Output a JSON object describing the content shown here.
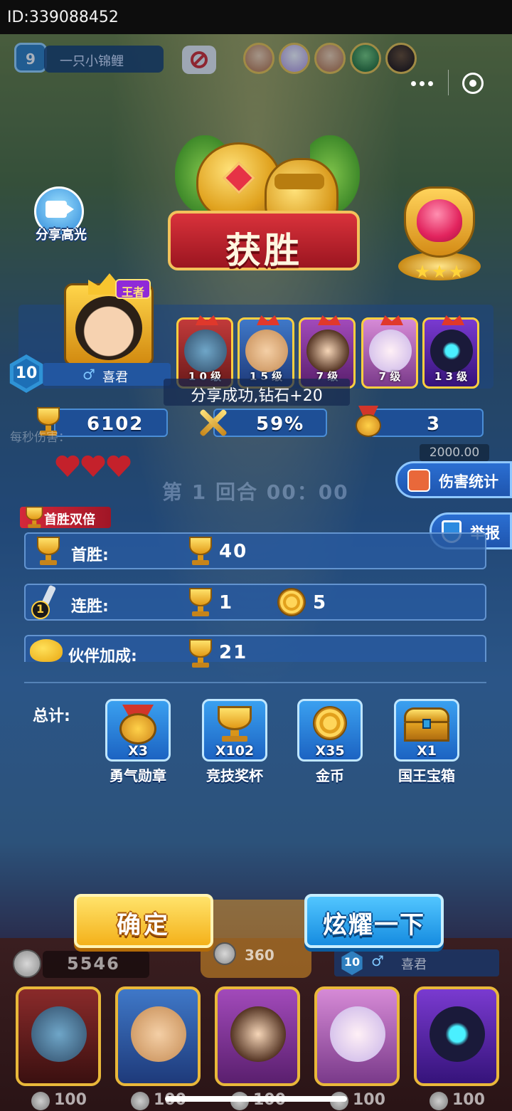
{
  "id_bar": {
    "text": "ID:339088452"
  },
  "hud": {
    "level": "9",
    "player_name": "一只小锦鲤",
    "mute_icon": "no-sound-icon"
  },
  "capsule": {
    "more_icon": "more-dots-icon",
    "close_icon": "target-close-icon"
  },
  "share_highlight": {
    "label": "分享高光",
    "icon": "video-camera-icon"
  },
  "victory": {
    "title": "获胜",
    "icon": "trophy-knight-icon"
  },
  "rank": {
    "icon": "heart-rank-badge-icon",
    "stars": 3
  },
  "player": {
    "crown_tag": "王者",
    "level": "10",
    "gender_icon": "♂",
    "name": "喜君",
    "heroes": [
      {
        "label": "1 0 级",
        "color": "#b02a2a"
      },
      {
        "label": "1 5 级",
        "color": "#2f5fb0"
      },
      {
        "label": "7 级",
        "color": "#8a3aa8"
      },
      {
        "label": "7 级",
        "color": "#c77cc7"
      },
      {
        "label": "1 3 级",
        "color": "#6b2ab0"
      }
    ]
  },
  "toast": "分享成功,钻石+20",
  "stats": {
    "trophies": "6102",
    "win_rate": "59%",
    "medals": "3"
  },
  "background": {
    "per_second": "每秒伤害：",
    "hp_value": "2000.00",
    "round": "第 1 回合 00：00"
  },
  "side_buttons": {
    "damage_stats": "伤害统计",
    "report": "举报"
  },
  "rewards": {
    "double_tag": "首胜双倍",
    "rows": [
      {
        "label": "首胜:",
        "trophy": "40"
      },
      {
        "label": "连胜:",
        "trophy": "1",
        "coin": "5",
        "badge": "1"
      },
      {
        "label": "伙伴加成:",
        "trophy": "21"
      }
    ],
    "total_label": "总计:",
    "totals": [
      {
        "count": "X3",
        "name": "勇气勋章",
        "icon": "courage-medal-icon"
      },
      {
        "count": "X102",
        "name": "竞技奖杯",
        "icon": "trophy-icon"
      },
      {
        "count": "X35",
        "name": "金币",
        "icon": "gold-coin-icon"
      },
      {
        "count": "X1",
        "name": "国王宝箱",
        "icon": "treasure-chest-icon"
      }
    ]
  },
  "buttons": {
    "confirm": "确定",
    "show_off": "炫耀一下"
  },
  "bottom": {
    "gold": "5546",
    "mid_value": "360",
    "enemy_level": "10",
    "enemy_gender": "♂",
    "enemy_name": "喜君",
    "hero_costs": [
      "100",
      "100",
      "100",
      "100",
      "100"
    ]
  }
}
